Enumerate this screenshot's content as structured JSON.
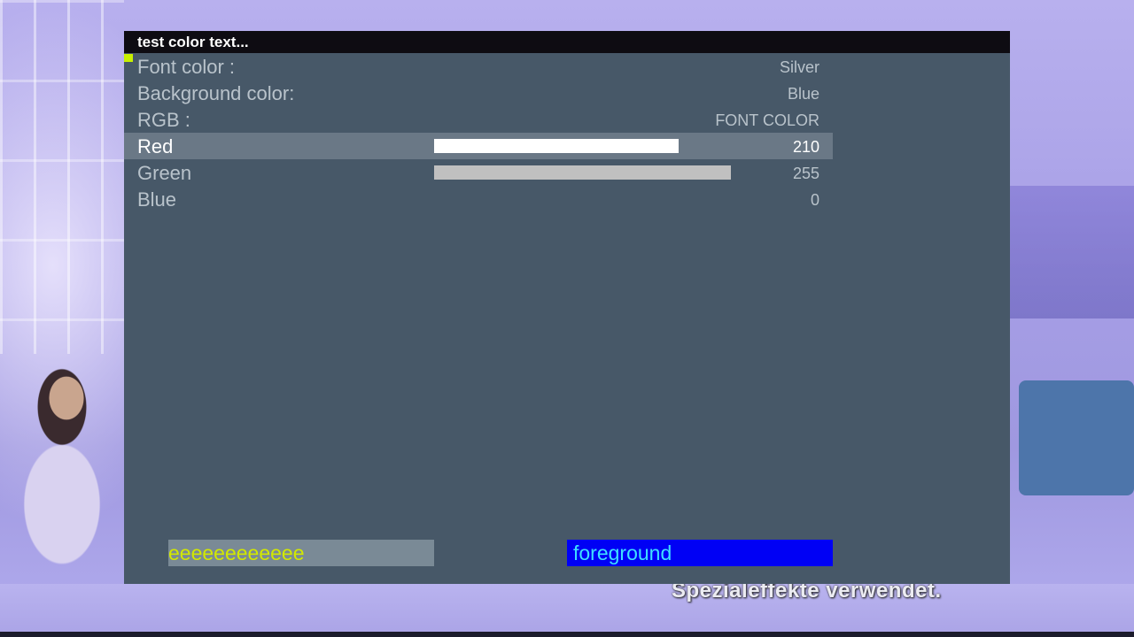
{
  "menu": {
    "title": "test color text...",
    "rows": [
      {
        "label": "Font color :",
        "value": "Silver"
      },
      {
        "label": "Background color:",
        "value": "Blue"
      },
      {
        "label": "RGB :",
        "value": "FONT COLOR"
      },
      {
        "label": "Red",
        "value": "210",
        "level": 210,
        "max": 255,
        "bar_color": "#ffffff",
        "selected": true
      },
      {
        "label": "Green",
        "value": "255",
        "level": 255,
        "max": 255,
        "bar_color": "#c0c0c0"
      },
      {
        "label": "Blue",
        "value": "0",
        "level": 0,
        "max": 255
      }
    ],
    "preview": {
      "sample_text": "eeeeeeeeeeee",
      "sample_text_color": "#d2e800",
      "foreground_label": "foreground",
      "foreground_bg_color": "#0000f5"
    }
  },
  "background": {
    "subtitle": "Spezialeffekte verwendet."
  },
  "colors": {
    "panel": "#475868",
    "title_bar": "#0e0c12",
    "selected_row": "#6a7886",
    "focus_marker": "#c8f000"
  }
}
